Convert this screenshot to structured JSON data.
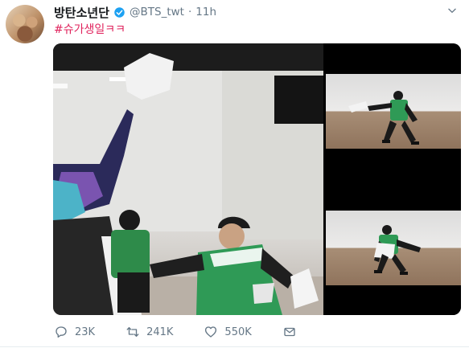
{
  "tweet": {
    "display_name": "방탄소년단",
    "handle": "@BTS_twt",
    "separator": "·",
    "time": "11h",
    "text": "#슈가생일ㅋㅋ"
  },
  "media": {
    "photo_count": 3
  },
  "actions": {
    "reply_count": "23K",
    "retweet_count": "241K",
    "like_count": "550K"
  },
  "colors": {
    "hashtag": "#e0245e",
    "verified": "#1da1f2",
    "muted": "#657786"
  }
}
